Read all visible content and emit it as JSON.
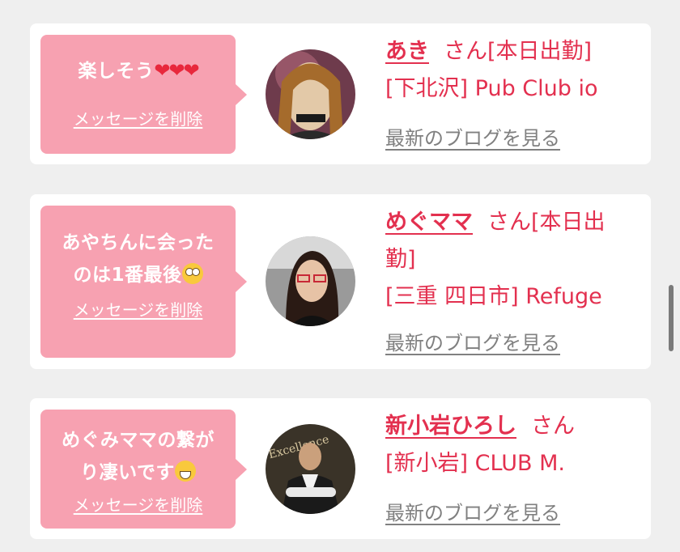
{
  "cards": [
    {
      "message": "楽しそう",
      "hearts": "❤❤❤",
      "delete_label": "メッセージを削除",
      "name": "あき",
      "suffix": "さん[本日出勤]",
      "location": "[下北沢] Pub Club io",
      "blog_link": "最新のブログを見る"
    },
    {
      "message_line1": "あやちんに会った",
      "message_line2": "のは1番最後",
      "delete_label": "メッセージを削除",
      "name": "めぐママ",
      "suffix": "さん[本日出",
      "suffix_line2": "勤]",
      "location": "[三重 四日市] Refuge",
      "blog_link": "最新のブログを見る"
    },
    {
      "message_line1": "めぐみママの繋が",
      "message_line2": "り凄いです",
      "delete_label": "メッセージを削除",
      "name": "新小岩ひろし",
      "suffix": "さん",
      "location": "[新小岩] CLUB M.",
      "blog_link": "最新のブログを見る"
    }
  ],
  "colors": {
    "bubble": "#f7a1b1",
    "accent": "#e3304f",
    "link_gray": "#808080",
    "background": "#efefef"
  }
}
